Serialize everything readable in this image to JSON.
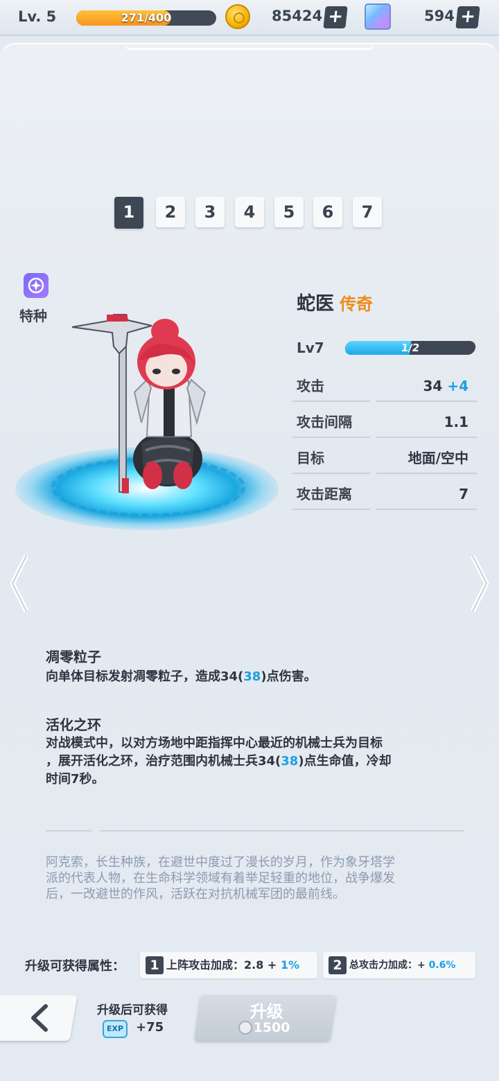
{
  "topbar": {
    "level": "Lv. 5",
    "xp_text": "271/400",
    "xp_progress": 0.6775,
    "coins": "85424",
    "coin_plus": "+",
    "gems": "594",
    "gem_plus": "+",
    "icons": [
      "coin-icon",
      "gem-cube-icon",
      "plus-icon"
    ]
  },
  "tabs": [
    "1",
    "2",
    "3",
    "4",
    "5",
    "6",
    "7"
  ],
  "active_tab": 0,
  "unit_class": {
    "label": "特种",
    "icon": "specialist-icon"
  },
  "hero": {
    "name": "蛇医",
    "rarity": "传奇",
    "rarity_color": "#f08a17",
    "level": "Lv7",
    "level_progress_text": "1/2",
    "level_progress": 0.5,
    "stats": [
      {
        "name": "攻击",
        "value": "34",
        "bonus": "+4"
      },
      {
        "name": "攻击间隔",
        "value": "1.1",
        "bonus": ""
      },
      {
        "name": "目标",
        "value": "地面/空中",
        "bonus": ""
      },
      {
        "name": "攻击距离",
        "value": "7",
        "bonus": ""
      }
    ]
  },
  "skills": [
    {
      "title": "凋零粒子",
      "desc_parts": [
        "向单体目标发射凋零粒子，造成34(",
        "38",
        ")点伤害。"
      ]
    },
    {
      "title": "活化之环",
      "desc_line1": "对战模式中，以对方场地中距指挥中心最近的机械士兵为目标",
      "desc_line2_parts": [
        "，展开活化之环，治疗范围内机械士兵34(",
        "38",
        ")点生命值，冷却"
      ],
      "desc_line3": "时间7秒。"
    }
  ],
  "lore": {
    "line1": "阿克索，长生种族，在避世中度过了漫长的岁月，作为象牙塔学",
    "line2": "派的代表人物，在生命科学领域有着举足轻重的地位，战争爆发",
    "line3": "后，一改避世的作风，活跃在对抗机械军团的最前线。"
  },
  "upgrade_attrs": {
    "label": "升级可获得属性：",
    "items": [
      {
        "num": "1",
        "text": "上阵攻击加成：2.8 + ",
        "bonus": "1%"
      },
      {
        "num": "2",
        "text": "总攻击力加成：+ ",
        "bonus": "0.6%"
      }
    ]
  },
  "bottom": {
    "after_label": "升级后可获得",
    "exp_icon_text": "EXP",
    "exp_gain": "+75",
    "upgrade_label": "升级",
    "upgrade_cost": "1500"
  },
  "colors": {
    "accent_blue": "#1e9fe0",
    "dark_slate": "#3e4754",
    "xp_orange": "#f7941d"
  }
}
